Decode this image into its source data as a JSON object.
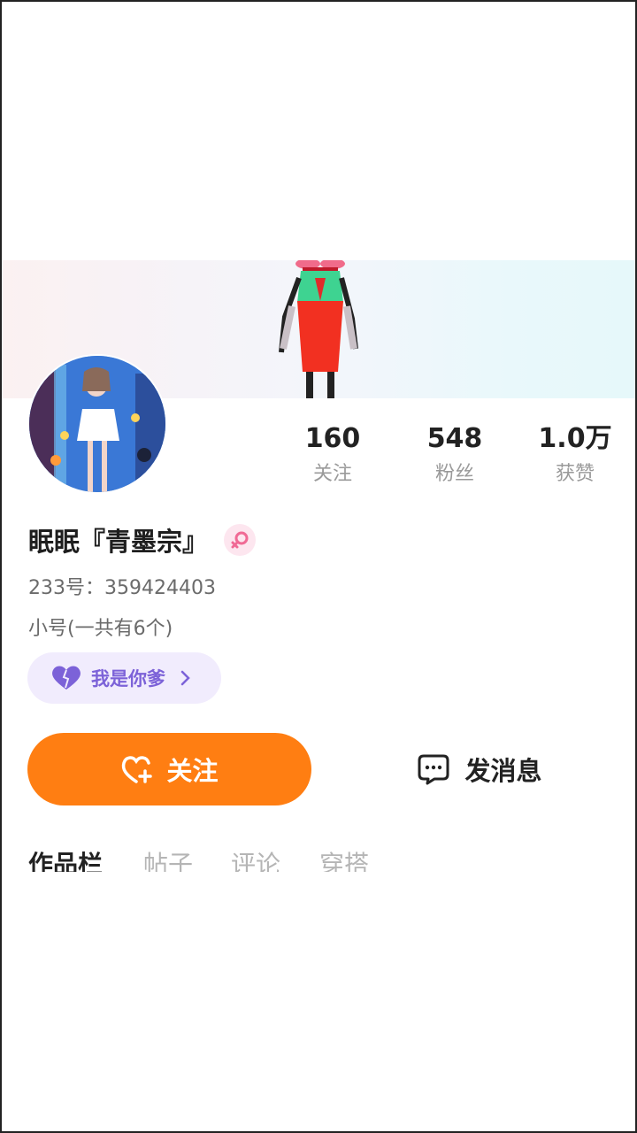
{
  "stats": [
    {
      "value": "160",
      "label": "关注"
    },
    {
      "value": "548",
      "label": "粉丝"
    },
    {
      "value": "1.0万",
      "label": "获赞"
    }
  ],
  "profile": {
    "name": "眠眠『青墨宗』",
    "id_text": "233号：359424403",
    "alt_accounts_text": "小号(一共有6个)",
    "badge_text": "我是你爹"
  },
  "actions": {
    "follow_label": "关注",
    "message_label": "发消息"
  },
  "tabs": [
    "作品栏",
    "帖子",
    "评论",
    "穿搭"
  ],
  "colors": {
    "follow_button": "#ff7e12",
    "badge_bg": "#f1ecfd",
    "badge_text": "#7c62d8"
  }
}
